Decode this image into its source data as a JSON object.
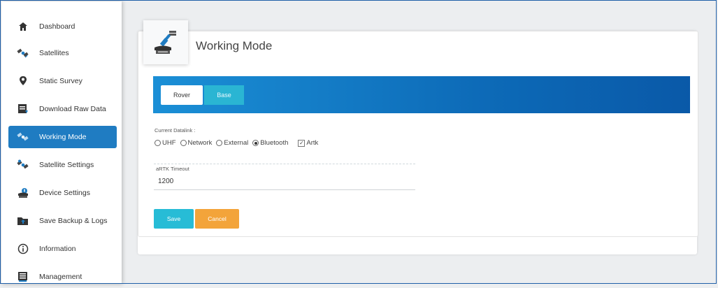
{
  "sidebar": {
    "items": [
      {
        "label": "Dashboard",
        "icon": "home-icon"
      },
      {
        "label": "Satellites",
        "icon": "satellite-icon"
      },
      {
        "label": "Static Survey",
        "icon": "location-pin-icon"
      },
      {
        "label": "Download Raw Data",
        "icon": "download-icon"
      },
      {
        "label": "Working Mode",
        "icon": "satellite-icon",
        "active": true
      },
      {
        "label": "Satellite Settings",
        "icon": "satellite-settings-icon"
      },
      {
        "label": "Device Settings",
        "icon": "device-settings-icon"
      },
      {
        "label": "Save Backup & Logs",
        "icon": "backup-icon"
      },
      {
        "label": "Information",
        "icon": "info-icon"
      },
      {
        "label": "Management",
        "icon": "management-icon"
      }
    ]
  },
  "page": {
    "title": "Working Mode",
    "icon": "working-mode-icon"
  },
  "tabs": {
    "rover": "Rover",
    "base": "Base",
    "selected": "Rover"
  },
  "datalink": {
    "label": "Current Datalink :",
    "options": [
      "UHF",
      "Network",
      "External",
      "Bluetooth"
    ],
    "selected": "Bluetooth",
    "artk_label": "Artk",
    "artk_checked": true
  },
  "timeout": {
    "label": "aRTK Timeout",
    "value": "1200"
  },
  "buttons": {
    "save": "Save",
    "cancel": "Cancel"
  },
  "colors": {
    "active_nav": "#1f7cc2",
    "banner": "#0d6bb8",
    "save": "#27bcd6",
    "cancel": "#f3a43a",
    "base_tab": "#2ab5d3"
  }
}
